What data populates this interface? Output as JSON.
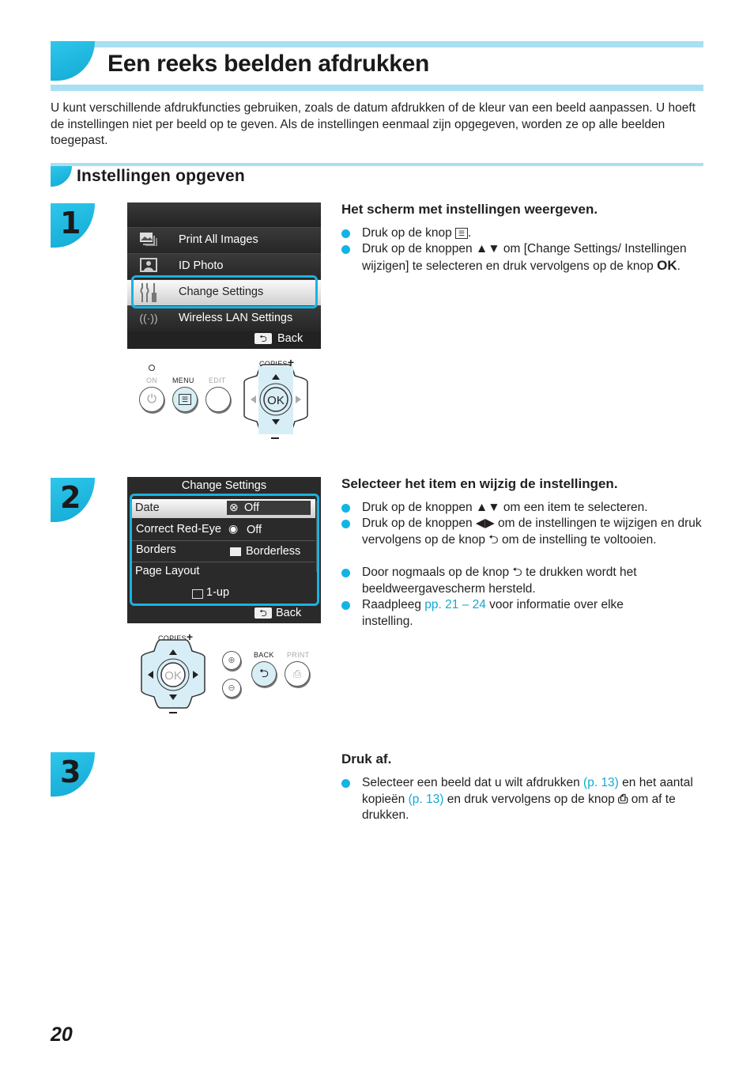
{
  "title": "Een reeks beelden afdrukken",
  "intro": "U kunt verschillende afdrukfuncties gebruiken, zoals de datum afdrukken of de kleur van een beeld aanpassen. U hoeft de instellingen niet per beeld op te geven. Als de instellingen eenmaal zijn opgegeven, worden ze op alle beelden toegepast.",
  "section_title": "Instellingen opgeven",
  "steps": [
    {
      "number": "1",
      "heading": "Het scherm met instellingen weergeven.",
      "bullets": [
        {
          "pre": "Druk op de knop ",
          "icon": "menu-button-icon",
          "post": "."
        },
        {
          "pre": "Druk op de knoppen ▲▼ om [Change Settings/ Instellingen wijzigen] te selecteren en druk vervolgens op de knop ",
          "icon": "ok-button-icon",
          "post": "."
        }
      ],
      "screen": {
        "items": [
          {
            "icon": "images-icon",
            "label": "Print All Images"
          },
          {
            "icon": "id-photo-icon",
            "label": "ID Photo"
          },
          {
            "icon": "tools-icon",
            "label": "Change Settings",
            "selected": true
          },
          {
            "icon": "wireless-icon",
            "label": "Wireless LAN Settings"
          }
        ],
        "back_label": "Back"
      },
      "controls": {
        "on": "ON",
        "menu": "MENU",
        "edit": "EDIT",
        "copies": "COPIES",
        "ok": "OK"
      }
    },
    {
      "number": "2",
      "heading": "Selecteer het item en wijzig de instellingen.",
      "bullets": [
        {
          "text": "Druk op de knoppen ▲▼ om een item te selecteren."
        },
        {
          "text": "Druk op de knoppen ◀▶ om de instellingen te wijzigen en druk vervolgens op de knop ⮌ om de instelling te voltooien."
        },
        {
          "text": "Door nogmaals op de knop ⮌ te drukken wordt het beeldweergavescherm hersteld."
        },
        {
          "pre": "Raadpleeg ",
          "link": "pp. 21 – 24",
          "post": " voor informatie over elke instelling."
        }
      ],
      "screen": {
        "title": "Change Settings",
        "items": [
          {
            "label": "Date",
            "value": "Off",
            "icon": "date-off-icon",
            "selected": true
          },
          {
            "label": "Correct Red-Eye",
            "value": "Off",
            "icon": "red-eye-off-icon"
          },
          {
            "label": "Borders",
            "value": "Borderless",
            "icon": "borderless-icon"
          },
          {
            "label": "Page Layout",
            "value": "1-up",
            "icon": "layout-icon"
          }
        ],
        "back_label": "Back"
      },
      "controls": {
        "copies": "COPIES",
        "ok": "OK",
        "back": "BACK",
        "print": "PRINT"
      }
    },
    {
      "number": "3",
      "heading": "Druk af.",
      "bullets": [
        {
          "pre": "Selecteer een beeld dat u wilt afdrukken ",
          "link": "(p. 13)",
          "mid": " en het aantal kopieën ",
          "link2": "(p. 13)",
          "post": " en druk vervolgens op de knop ",
          "icon": "print-icon",
          "post2": " om af te drukken."
        }
      ]
    }
  ],
  "page_number": "20",
  "colors": {
    "accent": "#12b4e6",
    "banner": "#a9dff2",
    "link": "#12a9d4"
  }
}
